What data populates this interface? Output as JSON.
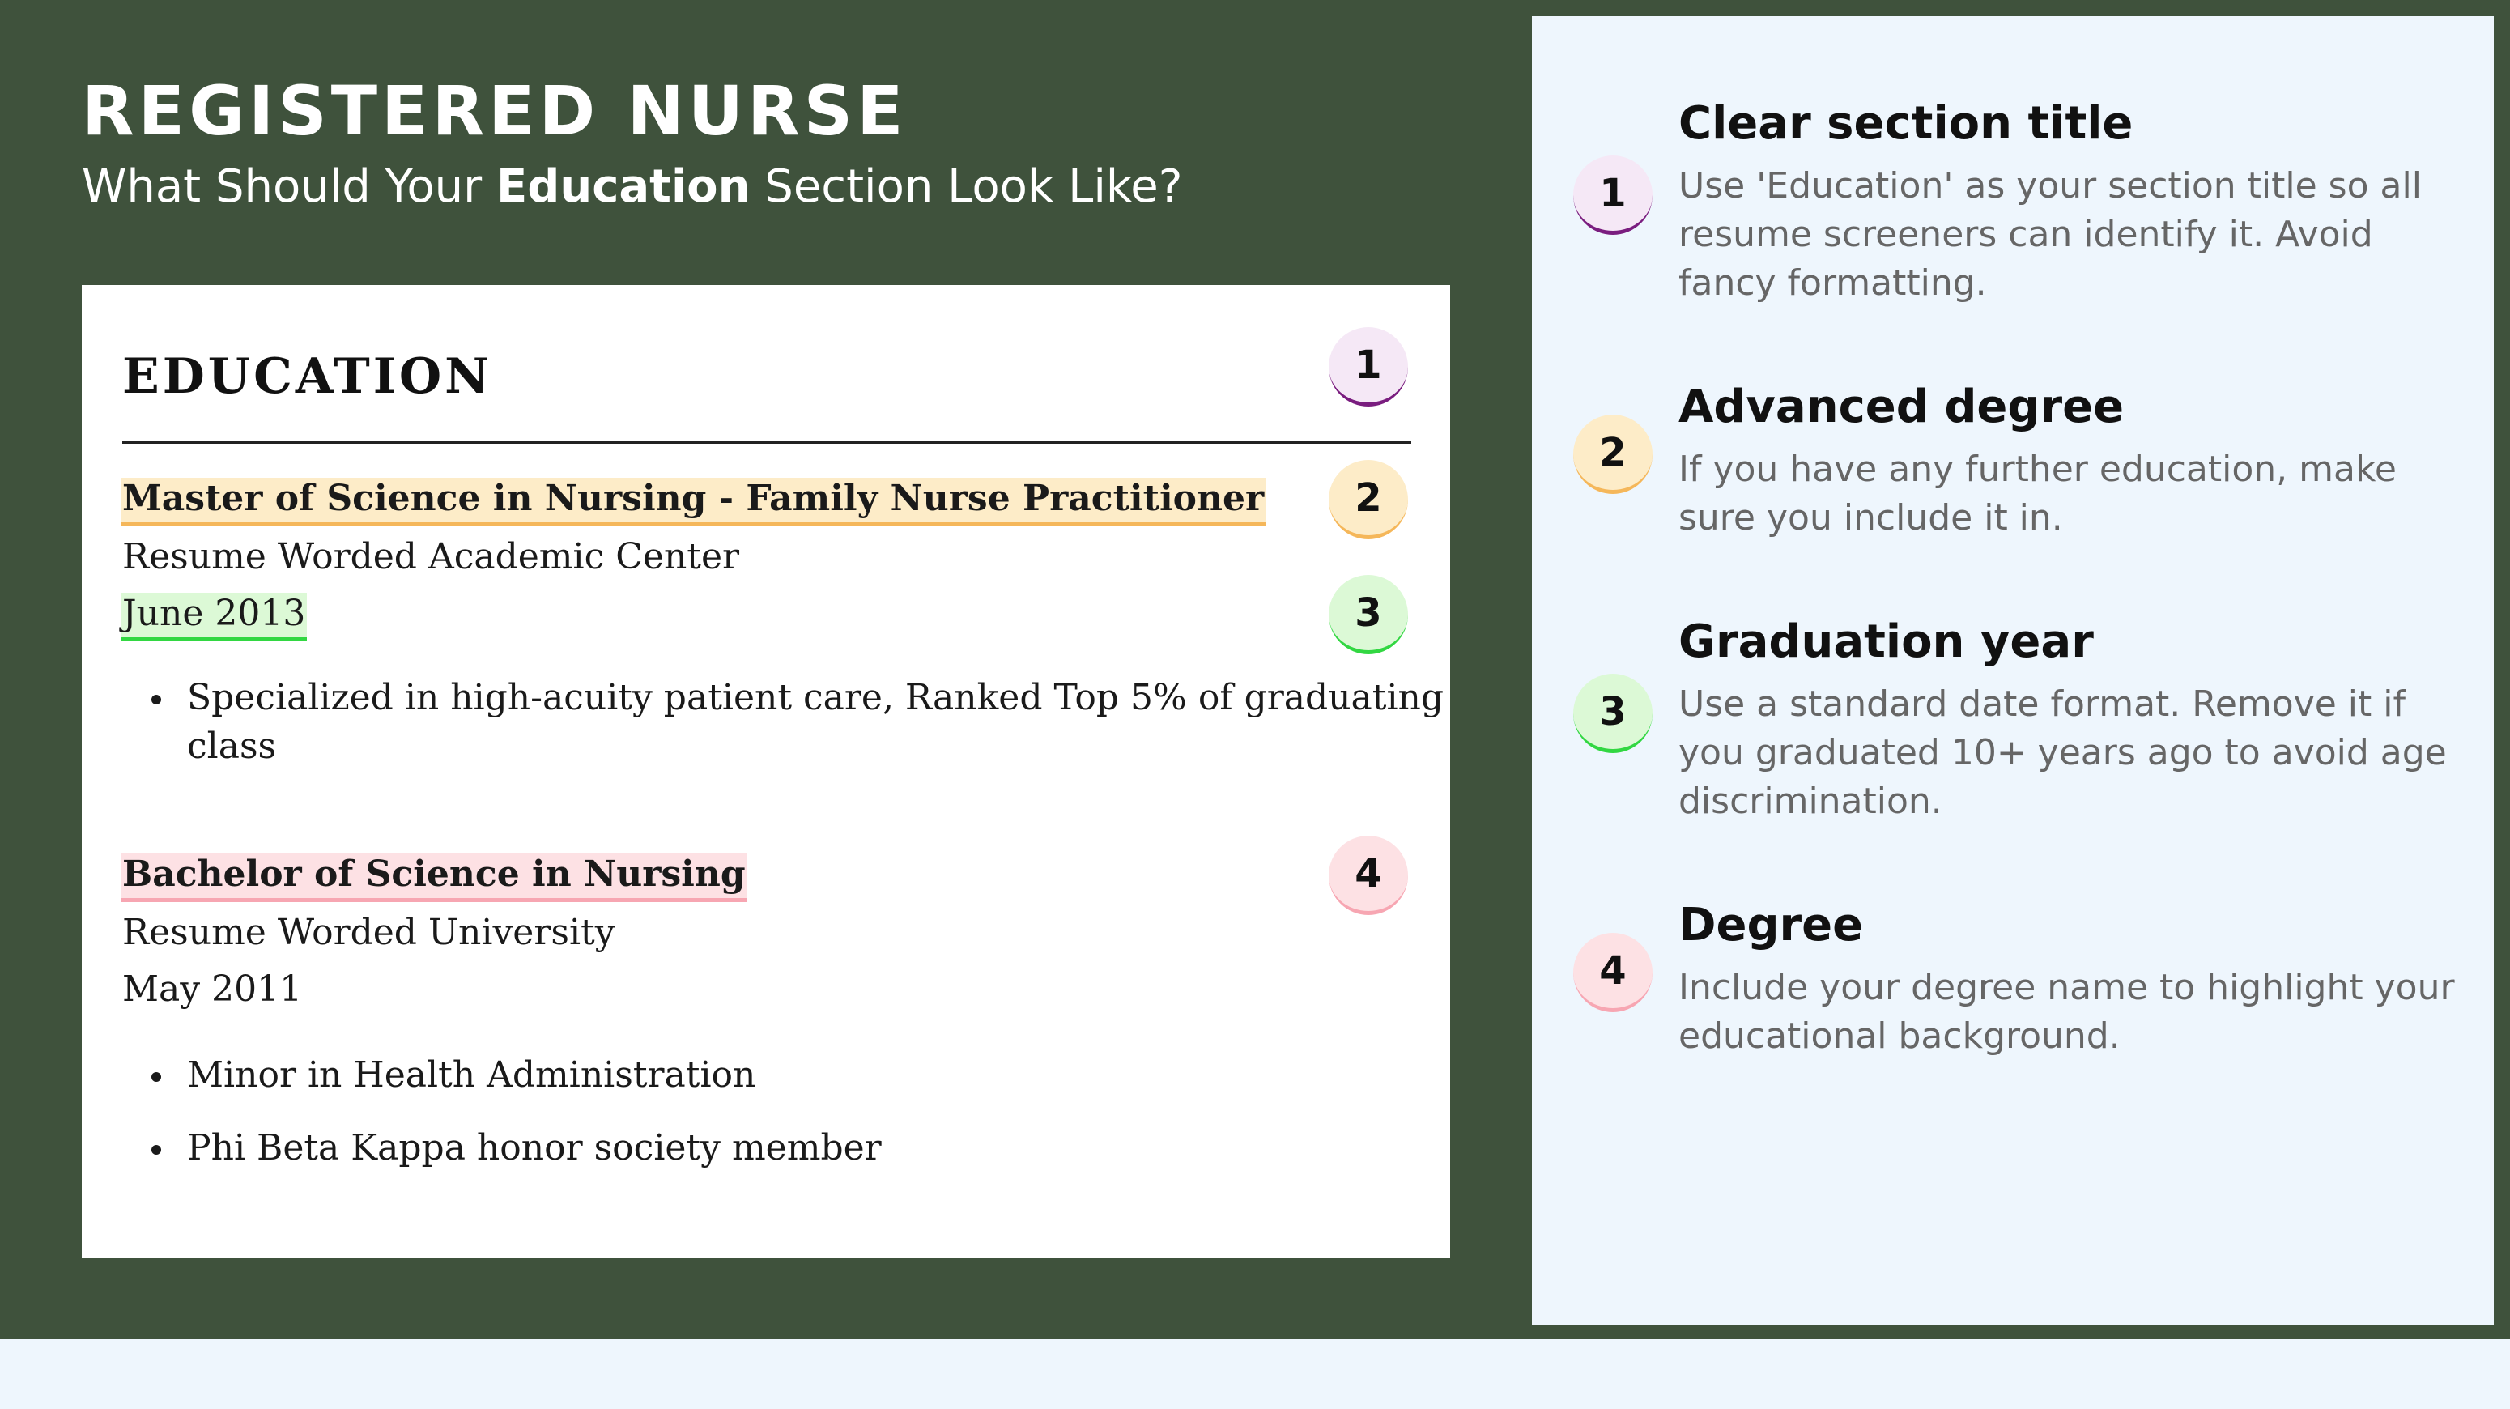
{
  "header": {
    "title": "REGISTERED NURSE",
    "subtitle_pre": "What Should Your ",
    "subtitle_bold": "Education",
    "subtitle_post": " Section Look Like?"
  },
  "resume": {
    "section_title": "EDUCATION",
    "entries": [
      {
        "degree": "Master of Science in Nursing - Family Nurse Practitioner",
        "school": "Resume Worded Academic Center",
        "date": "June 2013",
        "bullets": [
          "Specialized in high-acuity patient care, Ranked Top 5% of graduating",
          "class"
        ]
      },
      {
        "degree": "Bachelor of Science in Nursing",
        "school": "Resume Worded University",
        "date": "May 2011",
        "bullets": [
          "Minor in Health Administration",
          "Phi Beta Kappa honor society member"
        ]
      }
    ]
  },
  "badges": [
    "1",
    "2",
    "3",
    "4"
  ],
  "tips": [
    {
      "number": "1",
      "title": "Clear section title",
      "description": "Use 'Education' as your section title so all resume screeners can identify it. Avoid fancy formatting."
    },
    {
      "number": "2",
      "title": "Advanced degree",
      "description": "If you have any further education, make sure you include it in."
    },
    {
      "number": "3",
      "title": "Graduation year",
      "description": "Use a standard date format. Remove it if you graduated 10+ years ago to avoid age discrimination."
    },
    {
      "number": "4",
      "title": "Degree",
      "description": "Include your degree name to highlight your educational background."
    }
  ],
  "colors": {
    "background_green": "#3f523c",
    "panel": "#eef6fd",
    "badge1": "#7a1d7f",
    "badge2": "#f5b75a",
    "badge3": "#32d742",
    "badge4": "#f7a6b2"
  }
}
